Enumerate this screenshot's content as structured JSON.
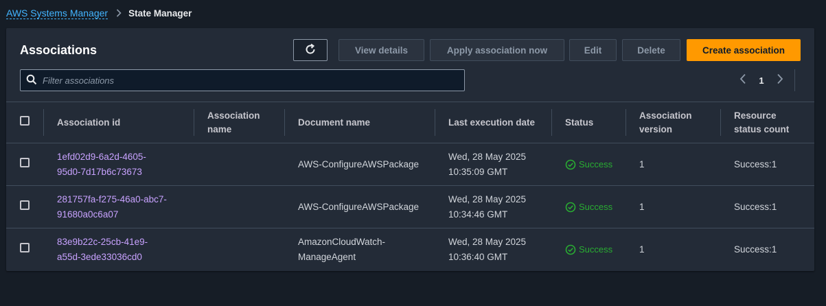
{
  "breadcrumb": {
    "parent": "AWS Systems Manager",
    "current": "State Manager"
  },
  "panel": {
    "title": "Associations",
    "buttons": {
      "view_details": "View details",
      "apply_now": "Apply association now",
      "edit": "Edit",
      "delete": "Delete",
      "create": "Create association"
    },
    "filter_placeholder": "Filter associations",
    "page_number": "1"
  },
  "table": {
    "headers": {
      "association_id": "Association id",
      "association_name": "Association name",
      "document_name": "Document name",
      "last_execution_date": "Last execution date",
      "status": "Status",
      "association_version": "Association version",
      "resource_status_count": "Resource status count"
    },
    "rows": [
      {
        "id_line1": "1efd02d9-6a2d-4605-",
        "id_line2": "95d0-7d17b6c73673",
        "name": "",
        "doc_line1": "AWS-ConfigureAWSPackage",
        "doc_line2": "",
        "date_line1": "Wed, 28 May 2025",
        "date_line2": "10:35:09 GMT",
        "status": "Success",
        "version": "1",
        "resource_count": "Success:1"
      },
      {
        "id_line1": "281757fa-f275-46a0-abc7-",
        "id_line2": "91680a0c6a07",
        "name": "",
        "doc_line1": "AWS-ConfigureAWSPackage",
        "doc_line2": "",
        "date_line1": "Wed, 28 May 2025",
        "date_line2": "10:34:46 GMT",
        "status": "Success",
        "version": "1",
        "resource_count": "Success:1"
      },
      {
        "id_line1": "83e9b22c-25cb-41e9-",
        "id_line2": "a55d-3ede33036cd0",
        "name": "",
        "doc_line1": "AmazonCloudWatch-",
        "doc_line2": "ManageAgent",
        "date_line1": "Wed, 28 May 2025",
        "date_line2": "10:36:40 GMT",
        "status": "Success",
        "version": "1",
        "resource_count": "Success:1"
      }
    ]
  },
  "colors": {
    "background": "#161d26",
    "panel": "#232b37",
    "primary": "#ff9900",
    "link": "#42b4ff",
    "association_link": "#c8a2ff",
    "success": "#29ad32"
  },
  "icons": {
    "refresh": "refresh-icon",
    "search": "search-icon",
    "prev": "chevron-left-icon",
    "next": "chevron-right-icon",
    "breadcrumb_separator": "chevron-right-icon",
    "status": "check-circle-icon"
  }
}
